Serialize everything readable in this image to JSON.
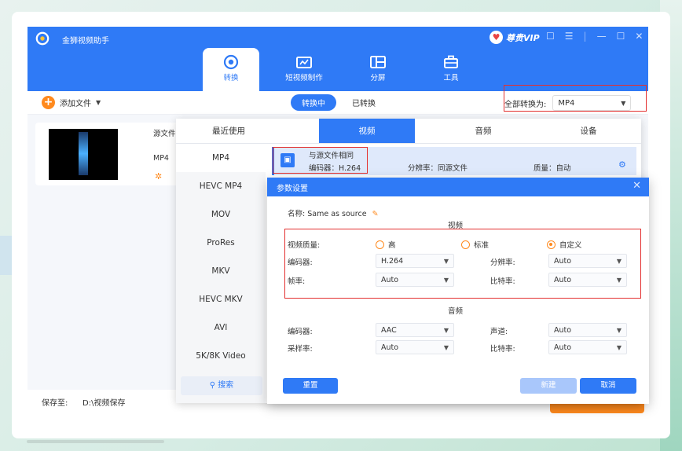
{
  "app": {
    "title": "金狮视频助手",
    "vip_label": "尊贵VIP"
  },
  "nav": [
    {
      "label": "转换",
      "icon": "convert-icon",
      "active": true
    },
    {
      "label": "短视频制作",
      "icon": "short-video-icon",
      "active": false
    },
    {
      "label": "分屏",
      "icon": "split-screen-icon",
      "active": false
    },
    {
      "label": "工具",
      "icon": "toolbox-icon",
      "active": false
    }
  ],
  "toolbar": {
    "add_file": "添加文件",
    "tab_converting": "转换中",
    "tab_converted": "已转换",
    "convert_all_label": "全部转换为:",
    "convert_all_value": "MP4"
  },
  "file": {
    "source_label": "源文件",
    "format": "MP4"
  },
  "bottom": {
    "save_to_label": "保存至:",
    "save_path": "D:\\视频保存"
  },
  "format_panel": {
    "tabs": [
      "最近使用",
      "视频",
      "音频",
      "设备"
    ],
    "active_tab": "视频",
    "formats": [
      "MP4",
      "HEVC MP4",
      "MOV",
      "ProRes",
      "MKV",
      "HEVC MKV",
      "AVI",
      "5K/8K Video"
    ],
    "search_label": "搜索",
    "preset": {
      "name": "与源文件相同",
      "encoder": "编码器：H.264",
      "resolution": "分辨率：同源文件",
      "quality": "质量：自动"
    }
  },
  "dialog": {
    "title": "参数设置",
    "name_label": "名称:",
    "name_value": "Same as source",
    "video_section": "视频",
    "quality_label": "视频质量:",
    "quality_options": [
      "高",
      "标准",
      "自定义"
    ],
    "quality_selected": "自定义",
    "video_encoder_label": "编码器:",
    "video_encoder_value": "H.264",
    "resolution_label": "分辨率:",
    "resolution_value": "Auto",
    "framerate_label": "帧率:",
    "framerate_value": "Auto",
    "video_bitrate_label": "比特率:",
    "video_bitrate_value": "Auto",
    "audio_section": "音频",
    "audio_encoder_label": "编码器:",
    "audio_encoder_value": "AAC",
    "channel_label": "声道:",
    "channel_value": "Auto",
    "samplerate_label": "采样率:",
    "samplerate_value": "Auto",
    "audio_bitrate_label": "比特率:",
    "audio_bitrate_value": "Auto",
    "reset_button": "重置",
    "new_button": "新建",
    "cancel_button": "取消"
  },
  "colors": {
    "primary": "#2f7af6",
    "accent": "#ff8a1e",
    "highlight": "#e3302f"
  }
}
